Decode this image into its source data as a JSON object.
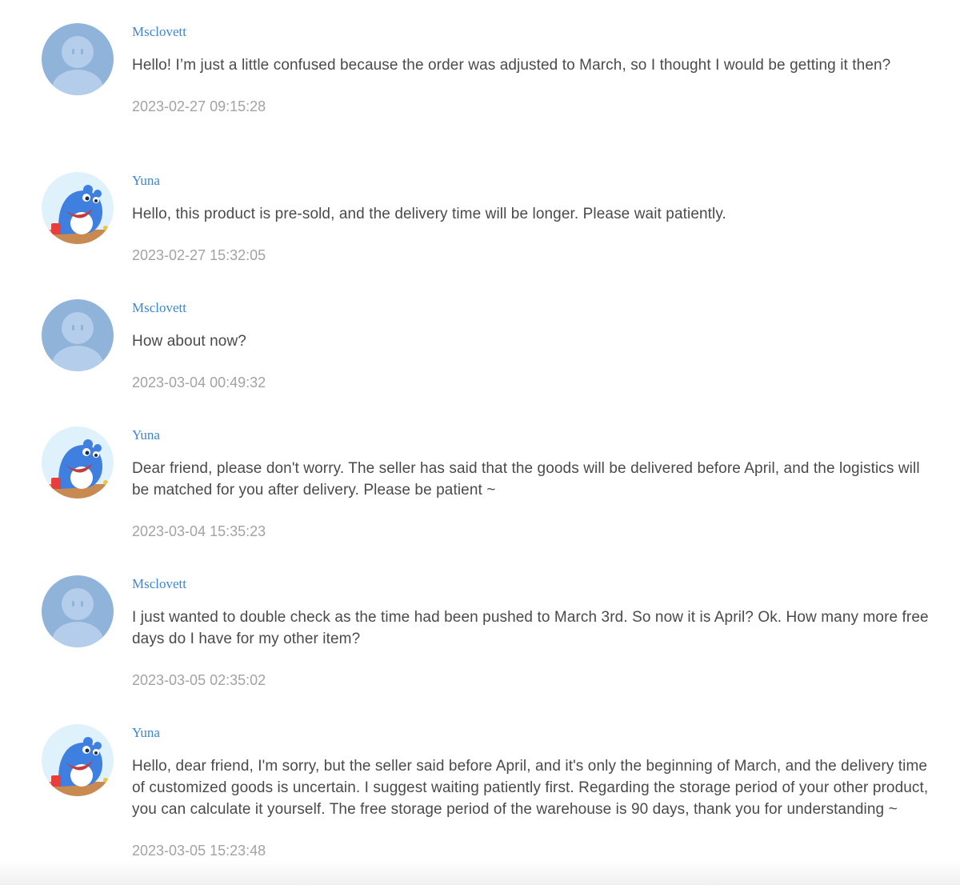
{
  "messages": [
    {
      "author": "Msclovett",
      "avatar": "default-user-avatar",
      "text": "Hello! I’m just a little confused because the order was adjusted to March, so I thought I would be getting it then?",
      "time": "2023-02-27 09:15:28"
    },
    {
      "author": "Yuna",
      "avatar": "blue-hippo-mascot-avatar",
      "text": "Hello, this product is pre-sold, and the delivery time will be longer. Please wait patiently.",
      "time": "2023-02-27 15:32:05"
    },
    {
      "author": "Msclovett",
      "avatar": "default-user-avatar",
      "text": "How about now?",
      "time": "2023-03-04 00:49:32"
    },
    {
      "author": "Yuna",
      "avatar": "blue-hippo-mascot-avatar",
      "text": "Dear friend, please don't worry. The seller has said that the goods will be delivered before April, and the logistics will be matched for you after delivery. Please be patient ~",
      "time": "2023-03-04 15:35:23"
    },
    {
      "author": "Msclovett",
      "avatar": "default-user-avatar",
      "text": "I just wanted to double check as the time had been pushed to March 3rd. So now it is April? Ok. How many more free days do I have for my other item?",
      "time": "2023-03-05 02:35:02"
    },
    {
      "author": "Yuna",
      "avatar": "blue-hippo-mascot-avatar",
      "text": "Hello, dear friend, I'm sorry, but the seller said before April, and it's only the beginning of March, and the delivery time of customized goods is uncertain. I suggest waiting patiently first. Regarding the storage period of your other product, you can calculate it yourself. The free storage period of the warehouse is 90 days, thank you for understanding ~",
      "time": "2023-03-05 15:23:48"
    }
  ],
  "colors": {
    "author_name": "#3a87d9",
    "message_text": "#4a4a4a",
    "timestamp": "#a3a3a3",
    "default_avatar_bg": "#8fb3d9",
    "default_avatar_fg": "#b3cdea"
  }
}
